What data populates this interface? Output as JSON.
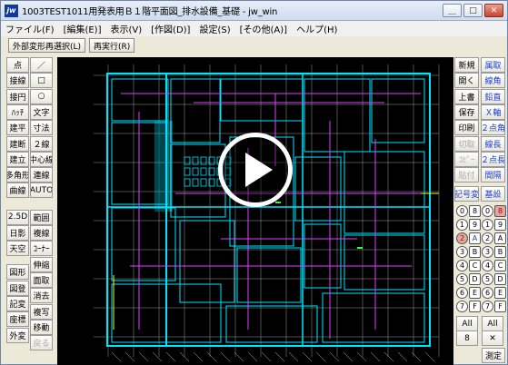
{
  "window": {
    "title": "1003TEST1011用発表用Ｂ１階平面図_排水設備_基礎 - jw_win",
    "app_icon_label": "jw"
  },
  "window_buttons": {
    "minimize": "＿",
    "maximize": "□",
    "close": "✕"
  },
  "menu": [
    {
      "label": "ファイル(F)"
    },
    {
      "label": "[編集(E)]"
    },
    {
      "label": "表示(V)"
    },
    {
      "label": "[作図(D)]"
    },
    {
      "label": "設定(S)"
    },
    {
      "label": "[その他(A)]"
    },
    {
      "label": "ヘルプ(H)"
    }
  ],
  "toolbar": {
    "external_transform": "外部変形再選択(L)",
    "re_execute": "再実行(R)"
  },
  "left_tools": [
    {
      "label": "点",
      "col": 0,
      "row": 0
    },
    {
      "label": "／",
      "col": 1,
      "row": 0
    },
    {
      "label": "接線",
      "col": 0,
      "row": 1
    },
    {
      "label": "□",
      "col": 1,
      "row": 1
    },
    {
      "label": "接円",
      "col": 0,
      "row": 2
    },
    {
      "label": "○",
      "col": 1,
      "row": 2
    },
    {
      "label": "ﾊｯﾁ",
      "col": 0,
      "row": 3
    },
    {
      "label": "文字",
      "col": 1,
      "row": 3
    },
    {
      "label": "建平",
      "col": 0,
      "row": 4
    },
    {
      "label": "寸法",
      "col": 1,
      "row": 4
    },
    {
      "label": "建断",
      "col": 0,
      "row": 5
    },
    {
      "label": "２線",
      "col": 1,
      "row": 5
    },
    {
      "label": "建立",
      "col": 0,
      "row": 6
    },
    {
      "label": "中心線",
      "col": 1,
      "row": 6
    },
    {
      "label": "多角形",
      "col": 0,
      "row": 7
    },
    {
      "label": "連線",
      "col": 1,
      "row": 7
    },
    {
      "label": "曲線",
      "col": 0,
      "row": 8
    },
    {
      "label": "AUTO",
      "col": 1,
      "row": 8
    },
    {
      "label": "2.5D",
      "col": 0,
      "row": 9.7
    },
    {
      "label": "範囲",
      "col": 1,
      "row": 9.7
    },
    {
      "label": "日影",
      "col": 0,
      "row": 10.7
    },
    {
      "label": "複線",
      "col": 1,
      "row": 10.7
    },
    {
      "label": "天空",
      "col": 0,
      "row": 11.7
    },
    {
      "label": "ｺｰﾅｰ",
      "col": 1,
      "row": 11.7
    },
    {
      "label": "伸縮",
      "col": 1,
      "row": 12.7
    },
    {
      "label": "図形",
      "col": 0,
      "row": 13.2
    },
    {
      "label": "面取",
      "col": 1,
      "row": 13.7
    },
    {
      "label": "図登",
      "col": 0,
      "row": 14.2
    },
    {
      "label": "消去",
      "col": 1,
      "row": 14.7
    },
    {
      "label": "記変",
      "col": 0,
      "row": 15.2
    },
    {
      "label": "複写",
      "col": 1,
      "row": 15.7
    },
    {
      "label": "座標",
      "col": 0,
      "row": 16.2
    },
    {
      "label": "移動",
      "col": 1,
      "row": 16.7
    },
    {
      "label": "外変",
      "col": 0,
      "row": 17.2
    },
    {
      "label": "戻る",
      "col": 1,
      "row": 17.7,
      "disabled": true
    }
  ],
  "right_tools": [
    {
      "label": "新規",
      "col": 0,
      "row": 0
    },
    {
      "label": "属取",
      "col": 1,
      "row": 0,
      "blue": true
    },
    {
      "label": "開く",
      "col": 0,
      "row": 1
    },
    {
      "label": "線角",
      "col": 1,
      "row": 1,
      "blue": true
    },
    {
      "label": "上書",
      "col": 0,
      "row": 2
    },
    {
      "label": "鉛直",
      "col": 1,
      "row": 2,
      "blue": true
    },
    {
      "label": "保存",
      "col": 0,
      "row": 3
    },
    {
      "label": "Ｘ軸",
      "col": 1,
      "row": 3,
      "blue": true
    },
    {
      "label": "印刷",
      "col": 0,
      "row": 4
    },
    {
      "label": "２点角",
      "col": 1,
      "row": 4,
      "blue": true
    },
    {
      "label": "切取",
      "col": 0,
      "row": 5,
      "disabled": true
    },
    {
      "label": "線長",
      "col": 1,
      "row": 5,
      "blue": true
    },
    {
      "label": "ｺﾋﾟｰ",
      "col": 0,
      "row": 6,
      "disabled": true
    },
    {
      "label": "２点長",
      "col": 1,
      "row": 6,
      "blue": true
    },
    {
      "label": "貼付",
      "col": 0,
      "row": 7,
      "disabled": true
    },
    {
      "label": "間隔",
      "col": 1,
      "row": 7,
      "blue": true
    },
    {
      "label": "線記号変形",
      "col": 0,
      "row": 8.2,
      "blue": true
    },
    {
      "label": "基設",
      "col": 1,
      "row": 8.2,
      "blue": true
    }
  ],
  "layer_buttons": [
    {
      "label": "0",
      "col": 0,
      "row": 0
    },
    {
      "label": "8",
      "col": 1,
      "row": 0
    },
    {
      "label": "0",
      "col": 2,
      "row": 0
    },
    {
      "label": "8",
      "col": 3,
      "row": 0,
      "red": true
    },
    {
      "label": "1",
      "col": 0,
      "row": 1
    },
    {
      "label": "9",
      "col": 1,
      "row": 1
    },
    {
      "label": "1",
      "col": 2,
      "row": 1
    },
    {
      "label": "9",
      "col": 3,
      "row": 1
    },
    {
      "label": "2",
      "col": 0,
      "row": 2,
      "red": true
    },
    {
      "label": "A",
      "col": 1,
      "row": 2,
      "blue": true
    },
    {
      "label": "2",
      "col": 2,
      "row": 2
    },
    {
      "label": "A",
      "col": 3,
      "row": 2
    },
    {
      "label": "3",
      "col": 0,
      "row": 3
    },
    {
      "label": "B",
      "col": 1,
      "row": 3
    },
    {
      "label": "3",
      "col": 2,
      "row": 3
    },
    {
      "label": "B",
      "col": 3,
      "row": 3
    },
    {
      "label": "4",
      "col": 0,
      "row": 4
    },
    {
      "label": "C",
      "col": 1,
      "row": 4
    },
    {
      "label": "4",
      "col": 2,
      "row": 4
    },
    {
      "label": "C",
      "col": 3,
      "row": 4
    },
    {
      "label": "5",
      "col": 0,
      "row": 5
    },
    {
      "label": "D",
      "col": 1,
      "row": 5
    },
    {
      "label": "5",
      "col": 2,
      "row": 5
    },
    {
      "label": "D",
      "col": 3,
      "row": 5
    },
    {
      "label": "6",
      "col": 0,
      "row": 6
    },
    {
      "label": "E",
      "col": 1,
      "row": 6
    },
    {
      "label": "6",
      "col": 2,
      "row": 6
    },
    {
      "label": "E",
      "col": 3,
      "row": 6
    },
    {
      "label": "7",
      "col": 0,
      "row": 7
    },
    {
      "label": "F",
      "col": 1,
      "row": 7
    },
    {
      "label": "7",
      "col": 2,
      "row": 7
    },
    {
      "label": "F",
      "col": 3,
      "row": 7
    }
  ],
  "layer_bottom": {
    "all_left": "All",
    "all_right": "All",
    "group_num": "8",
    "cross": "✕",
    "measure": "測定"
  },
  "colors": {
    "canvas_bg": "#000000",
    "wall_cyan": "#00e5ff",
    "pipe_magenta": "#e040fb",
    "grid_gray": "#bdbdbd",
    "yellow": "#ffff00",
    "green": "#33ff33",
    "play_button": "#ffffff"
  },
  "icons": {
    "play": "play-icon",
    "app": "jw-app-icon"
  }
}
